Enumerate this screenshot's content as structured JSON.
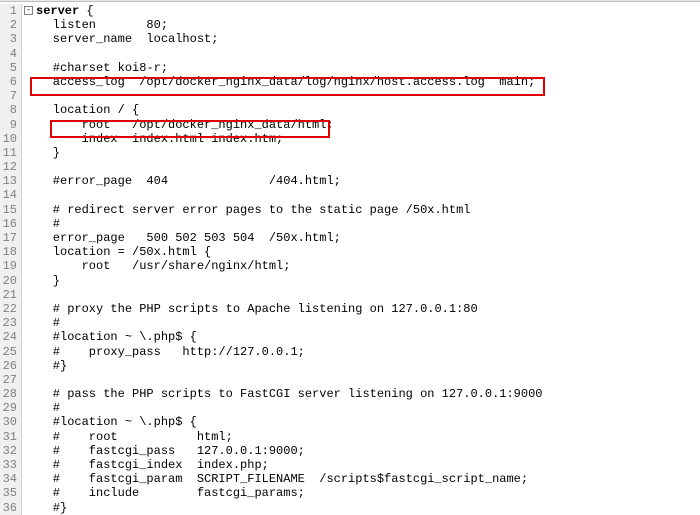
{
  "lines": [
    {
      "n": 1,
      "txt": "server {",
      "fold": true
    },
    {
      "n": 2,
      "txt": "    listen       80;"
    },
    {
      "n": 3,
      "txt": "    server_name  localhost;"
    },
    {
      "n": 4,
      "txt": ""
    },
    {
      "n": 5,
      "txt": "    #charset koi8-r;"
    },
    {
      "n": 6,
      "txt": "    access_log  /opt/docker_nginx_data/log/nginx/host.access.log  main;"
    },
    {
      "n": 7,
      "txt": ""
    },
    {
      "n": 8,
      "txt": "    location / {"
    },
    {
      "n": 9,
      "txt": "        root   /opt/docker_nginx_data/html;"
    },
    {
      "n": 10,
      "txt": "        index  index.html index.htm;"
    },
    {
      "n": 11,
      "txt": "    }"
    },
    {
      "n": 12,
      "txt": ""
    },
    {
      "n": 13,
      "txt": "    #error_page  404              /404.html;"
    },
    {
      "n": 14,
      "txt": ""
    },
    {
      "n": 15,
      "txt": "    # redirect server error pages to the static page /50x.html"
    },
    {
      "n": 16,
      "txt": "    #"
    },
    {
      "n": 17,
      "txt": "    error_page   500 502 503 504  /50x.html;"
    },
    {
      "n": 18,
      "txt": "    location = /50x.html {"
    },
    {
      "n": 19,
      "txt": "        root   /usr/share/nginx/html;"
    },
    {
      "n": 20,
      "txt": "    }"
    },
    {
      "n": 21,
      "txt": ""
    },
    {
      "n": 22,
      "txt": "    # proxy the PHP scripts to Apache listening on 127.0.0.1:80"
    },
    {
      "n": 23,
      "txt": "    #"
    },
    {
      "n": 24,
      "txt": "    #location ~ \\.php$ {"
    },
    {
      "n": 25,
      "txt": "    #    proxy_pass   http://127.0.0.1;"
    },
    {
      "n": 26,
      "txt": "    #}"
    },
    {
      "n": 27,
      "txt": ""
    },
    {
      "n": 28,
      "txt": "    # pass the PHP scripts to FastCGI server listening on 127.0.0.1:9000"
    },
    {
      "n": 29,
      "txt": "    #"
    },
    {
      "n": 30,
      "txt": "    #location ~ \\.php$ {"
    },
    {
      "n": 31,
      "txt": "    #    root           html;"
    },
    {
      "n": 32,
      "txt": "    #    fastcgi_pass   127.0.0.1:9000;"
    },
    {
      "n": 33,
      "txt": "    #    fastcgi_index  index.php;"
    },
    {
      "n": 34,
      "txt": "    #    fastcgi_param  SCRIPT_FILENAME  /scripts$fastcgi_script_name;"
    },
    {
      "n": 35,
      "txt": "    #    include        fastcgi_params;"
    },
    {
      "n": 36,
      "txt": "    #}"
    }
  ],
  "fold_symbol": "-"
}
